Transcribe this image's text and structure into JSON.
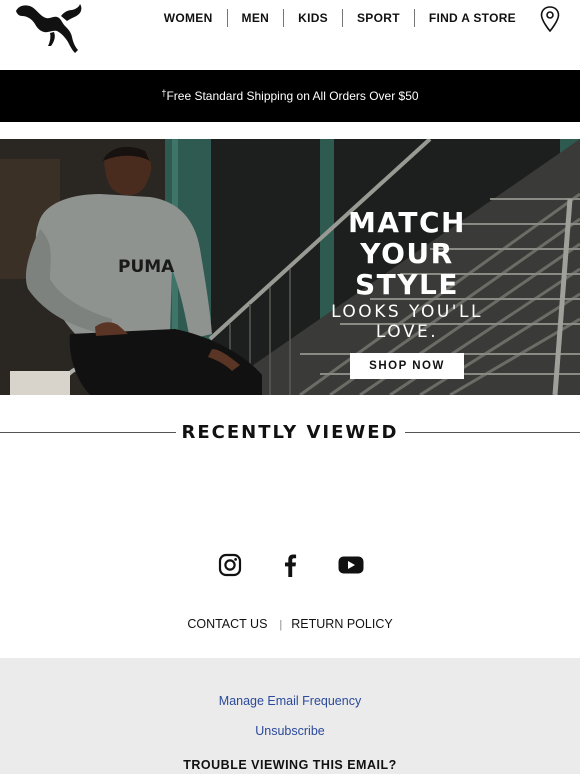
{
  "nav": {
    "items": [
      "WOMEN",
      "MEN",
      "KIDS",
      "SPORT",
      "FIND A STORE"
    ]
  },
  "icons": {
    "logo": "puma-cat-logo",
    "store": "location-pin-icon",
    "social": [
      "instagram-icon",
      "facebook-icon",
      "youtube-icon"
    ]
  },
  "promo": {
    "mark": "†",
    "text": "Free Standard Shipping on All Orders Over $50"
  },
  "hero": {
    "title_line1": "MATCH YOUR",
    "title_line2": "STYLE",
    "subtitle": "LOOKS YOU'LL LOVE.",
    "cta": "SHOP NOW",
    "hoodie_text": "PUMA"
  },
  "recent": {
    "title": "RECENTLY VIEWED"
  },
  "links": {
    "contact": "CONTACT US",
    "separator": "|",
    "returns": "RETURN POLICY"
  },
  "footer": {
    "manage": "Manage Email Frequency",
    "unsubscribe": "Unsubscribe",
    "trouble": "TROUBLE VIEWING THIS EMAIL?"
  },
  "colors": {
    "promo_bg": "#000000",
    "footer_bg": "#ebebeb",
    "link_blue": "#2b4a9b"
  }
}
